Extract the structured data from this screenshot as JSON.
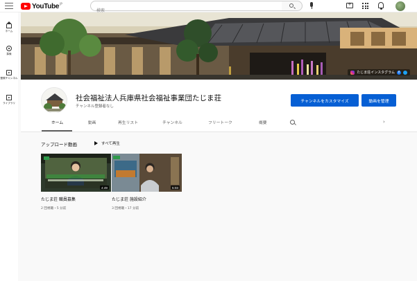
{
  "topbar": {
    "logo_text": "YouTube",
    "logo_region": "JP",
    "search_placeholder": "検索"
  },
  "leftnav": {
    "items": [
      {
        "label": "ホーム"
      },
      {
        "label": "探索"
      },
      {
        "label": "登録チャンネル"
      },
      {
        "label": "ライブラリ"
      }
    ]
  },
  "banner": {
    "link_text": "たじま荘インスタグラム",
    "fb_letter": "f"
  },
  "channel": {
    "name": "社会福祉法人兵庫県社会福祉事業団たじま荘",
    "subscribers": "チャンネル登録者なし",
    "customize_label": "チャンネルをカスタマイズ",
    "manage_label": "動画を管理"
  },
  "tabs": {
    "items": [
      {
        "label": "ホーム",
        "active": true
      },
      {
        "label": "動画",
        "active": false
      },
      {
        "label": "再生リスト",
        "active": false
      },
      {
        "label": "チャンネル",
        "active": false
      },
      {
        "label": "フリートーク",
        "active": false
      },
      {
        "label": "概要",
        "active": false
      }
    ],
    "next_icon": "›"
  },
  "uploads": {
    "title": "アップロード動画",
    "play_all": "すべて再生",
    "videos": [
      {
        "title": "たじま荘 職員募集",
        "meta": "2 回視聴・5 分前",
        "duration": "4:49"
      },
      {
        "title": "たじま荘 施設紹介",
        "meta": "3 回視聴・17 分前",
        "duration": "5:03"
      }
    ]
  },
  "colors": {
    "brand_red": "#ff0000",
    "button_blue": "#065fd4",
    "background": "#f9f9f9"
  }
}
